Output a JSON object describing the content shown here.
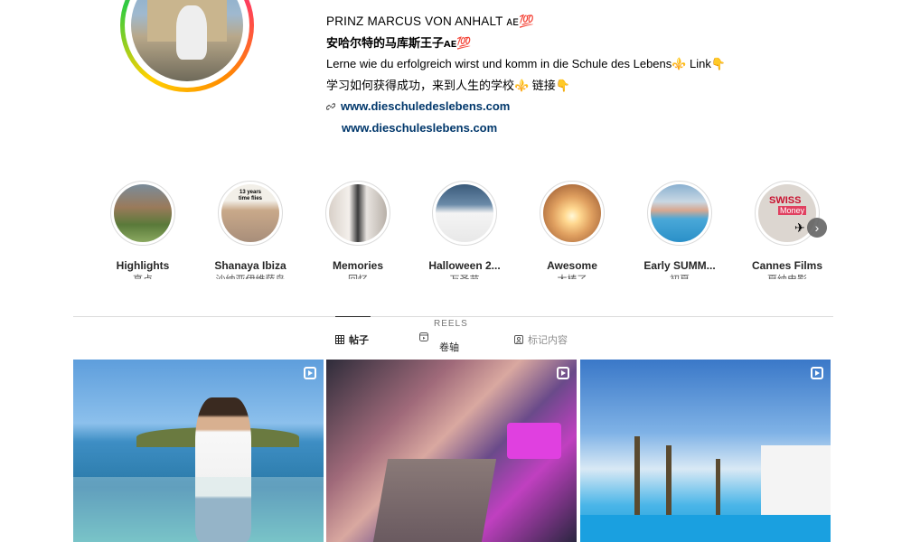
{
  "profile": {
    "name": "PRINZ MARCUS VON ANHALT ᴀᴇ💯",
    "name_zh": "安哈尔特的马库斯王子ᴀᴇ💯",
    "bio_de": "Lerne wie du erfolgreich wirst und komm in die Schule des Lebens⚜️ Link👇",
    "bio_zh": "学习如何获得成功，来到人生的学校⚜️ 链接👇",
    "link1": "www.dieschuledeslebens.com",
    "link2": "www.dieschuleslebens.com"
  },
  "highlights": [
    {
      "label": "Highlights",
      "sub": "亮点",
      "thumb": "people-outdoor",
      "color": "#6b8f4e"
    },
    {
      "label": "Shanaya Ibiza",
      "sub": "沙纳亚伊维萨岛",
      "thumb": "time-flies-collage",
      "color": "#b9a48c"
    },
    {
      "label": "Memories",
      "sub": "回忆",
      "thumb": "couple-photo",
      "color": "#c8c0b8"
    },
    {
      "label": "Halloween 2...",
      "sub": "万圣节",
      "thumb": "map-screenshot",
      "color": "#5c7f9c"
    },
    {
      "label": "Awesome",
      "sub": "太棒了",
      "thumb": "glow-light",
      "color": "#e8b070"
    },
    {
      "label": "Early SUMM...",
      "sub": "初夏",
      "thumb": "pool-person",
      "color": "#5aa8d6"
    },
    {
      "label": "Cannes Films",
      "sub": "戛纳电影",
      "thumb": "swiss-money",
      "color": "#d8d0c8"
    }
  ],
  "tabs": {
    "posts": "帖子",
    "reels_en": "REELS",
    "reels_zh": "卷轴",
    "tagged": "标记内容"
  },
  "highlight_texts": {
    "time_flies": "13 years\ntime flies",
    "swiss": "SWISS",
    "money": "Money"
  },
  "posts": [
    {
      "name": "post-man-sea",
      "reel": true
    },
    {
      "name": "post-villa-aerial",
      "reel": true
    },
    {
      "name": "post-pool-palms",
      "reel": true
    }
  ]
}
